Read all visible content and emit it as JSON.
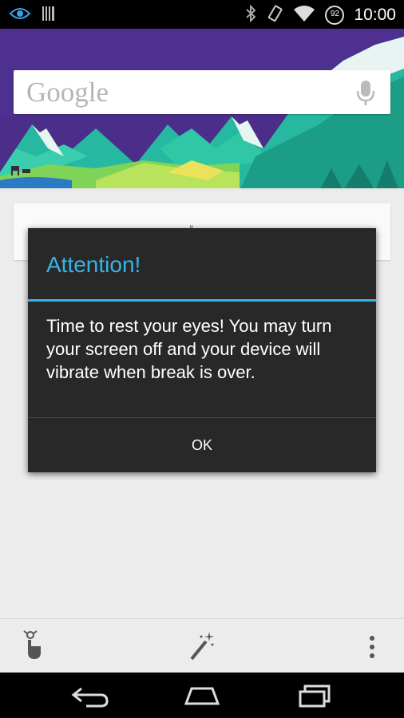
{
  "status_bar": {
    "time": "10:00",
    "battery_level": "92",
    "icons": [
      "eye-icon",
      "barcode-icon",
      "bluetooth-icon",
      "vibrate-icon",
      "wifi-icon",
      "battery-icon"
    ]
  },
  "search": {
    "logo_text": "Google",
    "mic_icon": "mic-icon"
  },
  "card": {
    "peek_text": "\""
  },
  "dialog": {
    "title": "Attention!",
    "message": "Time to rest your eyes! You may turn your screen off and your device will vibrate when break is over.",
    "ok_label": "OK"
  },
  "bottom_bar": {
    "icons": [
      "reminder-finger-icon",
      "magic-wand-icon",
      "overflow-menu-icon"
    ]
  },
  "nav_bar": {
    "icons": [
      "back-icon",
      "home-icon",
      "recents-icon"
    ]
  },
  "colors": {
    "accent": "#33b5e5",
    "dialog_bg": "#282828",
    "sky": "#4a2e8a"
  }
}
